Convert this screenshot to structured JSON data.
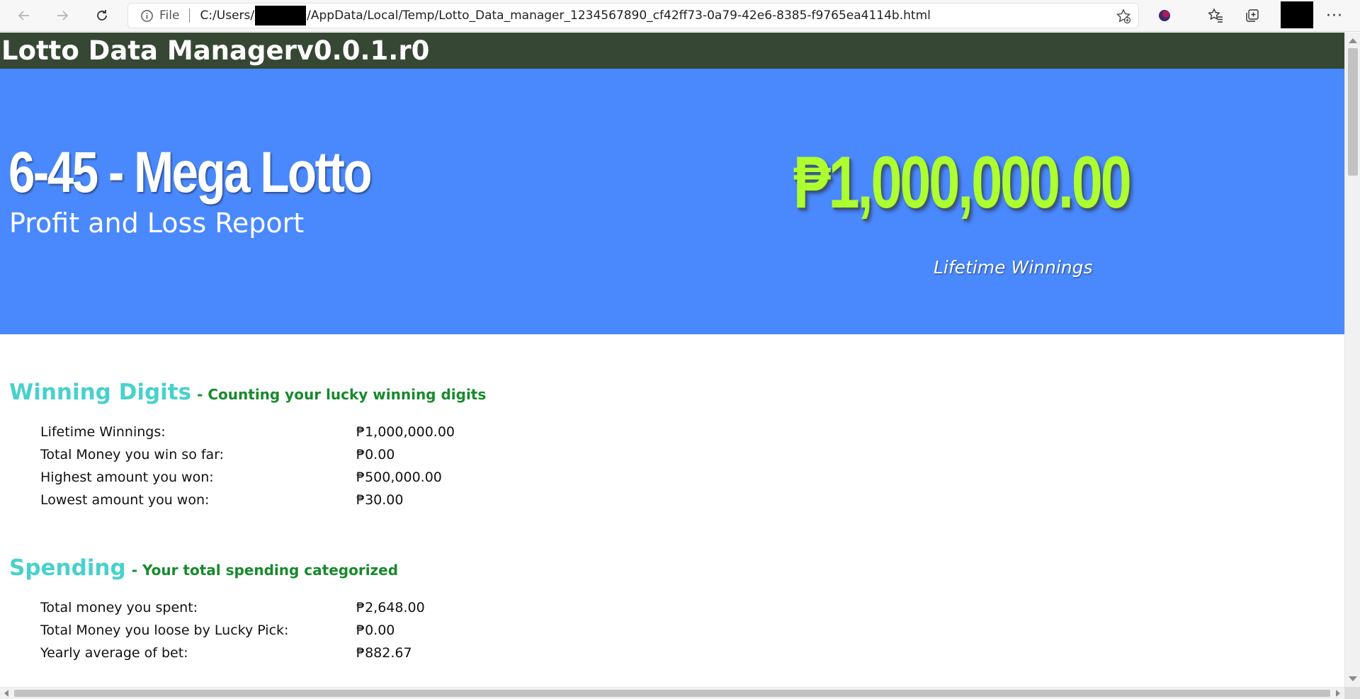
{
  "browser": {
    "scheme_label": "File",
    "url_prefix": "C:/Users/",
    "url_suffix": "/AppData/Local/Temp/Lotto_Data_manager_1234567890_cf42ff73-0a79-42e6-8385-f9765ea4114b.html",
    "more_label": "···"
  },
  "app": {
    "header_title": "Lotto Data Managerv0.0.1.r0"
  },
  "hero": {
    "game_title": "6-45 - Mega Lotto",
    "report_subtitle": "Profit and Loss Report",
    "lifetime_amount": "₱1,000,000.00",
    "lifetime_label": "Lifetime Winnings"
  },
  "colors": {
    "header_bg": "#364834",
    "hero_bg": "#4a89fd",
    "amount_green": "#adff2f",
    "section_title": "#48d1cc",
    "section_subtitle": "#178a2c"
  },
  "sections": {
    "winning": {
      "title": "Winning Digits",
      "subtitle": "- Counting your lucky winning digits",
      "rows": [
        {
          "label": "Lifetime Winnings:",
          "value": "₱1,000,000.00"
        },
        {
          "label": "Total Money you win so far:",
          "value": "₱0.00"
        },
        {
          "label": "Highest amount you won:",
          "value": "₱500,000.00"
        },
        {
          "label": "Lowest amount you won:",
          "value": "₱30.00"
        }
      ]
    },
    "spending": {
      "title": "Spending",
      "subtitle": "- Your total spending categorized",
      "rows": [
        {
          "label": "Total money you spent:",
          "value": "₱2,648.00"
        },
        {
          "label": "Total Money you loose by Lucky Pick:",
          "value": "₱0.00"
        },
        {
          "label": "Yearly average of bet:",
          "value": "₱882.67"
        }
      ]
    }
  },
  "icons": {
    "back": "arrow-left-icon",
    "forward": "arrow-right-icon",
    "refresh": "refresh-icon",
    "info": "info-icon",
    "add_favorite": "star-plus-icon",
    "extension": "extension-icon",
    "favorites": "favorites-icon",
    "collections": "collections-icon",
    "more": "more-icon"
  }
}
